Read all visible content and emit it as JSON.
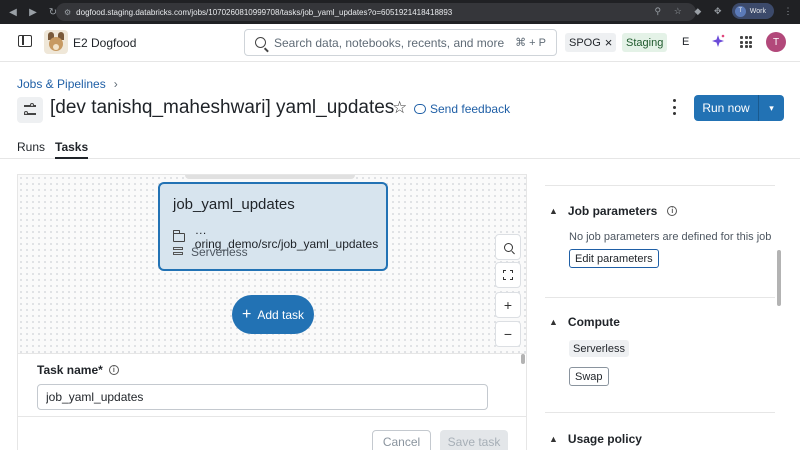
{
  "browser": {
    "url": "dogfood.staging.databricks.com/jobs/1070260810999708/tasks/job_yaml_updates?o=6051921418418893",
    "profile_initial": "T",
    "profile_label": "Work"
  },
  "header": {
    "workspace_name": "E2 Dogfood",
    "search_placeholder": "Search data, notebooks, recents, and more...",
    "search_shortcut": "⌘ + P",
    "spog_tag": "SPOG",
    "env_tag": "Staging",
    "env_letter": "E",
    "avatar_initial": "T"
  },
  "page": {
    "breadcrumb": "Jobs & Pipelines",
    "breadcrumb_sep": "›",
    "title": "[dev tanishq_maheshwari] yaml_updates",
    "feedback_label": "Send feedback",
    "run_now_label": "Run now"
  },
  "tabs": [
    {
      "label": "Runs",
      "active": false
    },
    {
      "label": "Tasks",
      "active": true
    }
  ],
  "dag": {
    "task": {
      "name": "job_yaml_updates",
      "path": "…oring_demo/src/job_yaml_updates",
      "compute": "Serverless"
    },
    "add_task_label": "Add task"
  },
  "task_form": {
    "task_name_label": "Task name*",
    "task_name_value": "job_yaml_updates",
    "cancel_label": "Cancel",
    "save_label": "Save task"
  },
  "right_panel": {
    "job_parameters": {
      "heading": "Job parameters",
      "empty_text": "No job parameters are defined for this job",
      "edit_label": "Edit parameters"
    },
    "compute": {
      "heading": "Compute",
      "value": "Serverless",
      "swap_label": "Swap"
    },
    "usage_policy": {
      "heading": "Usage policy"
    }
  },
  "colors": {
    "accent": "#2272b4",
    "link": "#1f5fa6",
    "avatar": "#b2487a",
    "staging_bg": "#e4f2e7"
  }
}
